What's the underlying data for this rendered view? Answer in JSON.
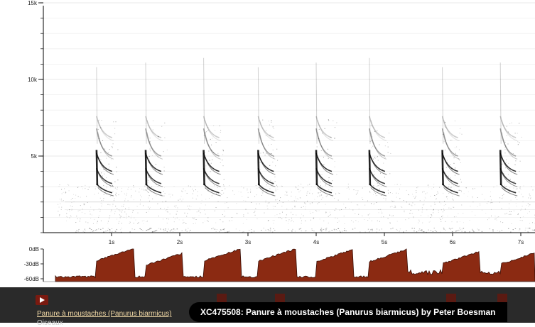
{
  "player": {
    "caption": "XC475508: Panure à moustaches (Panurus biarmicus) by Peter Boesman",
    "underlying_title": "Panure à moustaches (Panurus biarmicus)",
    "underlying_subtitle": "Oiseaux"
  },
  "spectrogram": {
    "y_ticks": [
      {
        "value": 5,
        "label": "5k"
      },
      {
        "value": 10,
        "label": "10k"
      },
      {
        "value": 15,
        "label": "15k"
      }
    ],
    "x_ticks": [
      {
        "value": 1,
        "label": "1s"
      },
      {
        "value": 2,
        "label": "2s"
      },
      {
        "value": 3,
        "label": "3s"
      },
      {
        "value": 4,
        "label": "4s"
      },
      {
        "value": 5,
        "label": "5s"
      },
      {
        "value": 6,
        "label": "6s"
      },
      {
        "value": 7,
        "label": "7s"
      }
    ],
    "calls_at_seconds": [
      0.78,
      1.5,
      2.35,
      3.15,
      4.0,
      4.78,
      5.85,
      6.7
    ]
  },
  "waveform": {
    "db_ticks": [
      {
        "value": 0,
        "label": "0dB"
      },
      {
        "value": -30,
        "label": "-30dB"
      },
      {
        "value": -60,
        "label": "-60dB"
      }
    ],
    "fill_color": "#8b2a12"
  },
  "colors": {
    "caption_bg": "#000000",
    "bar_bg": "#2a2a2a",
    "accent": "#8b2a12"
  }
}
